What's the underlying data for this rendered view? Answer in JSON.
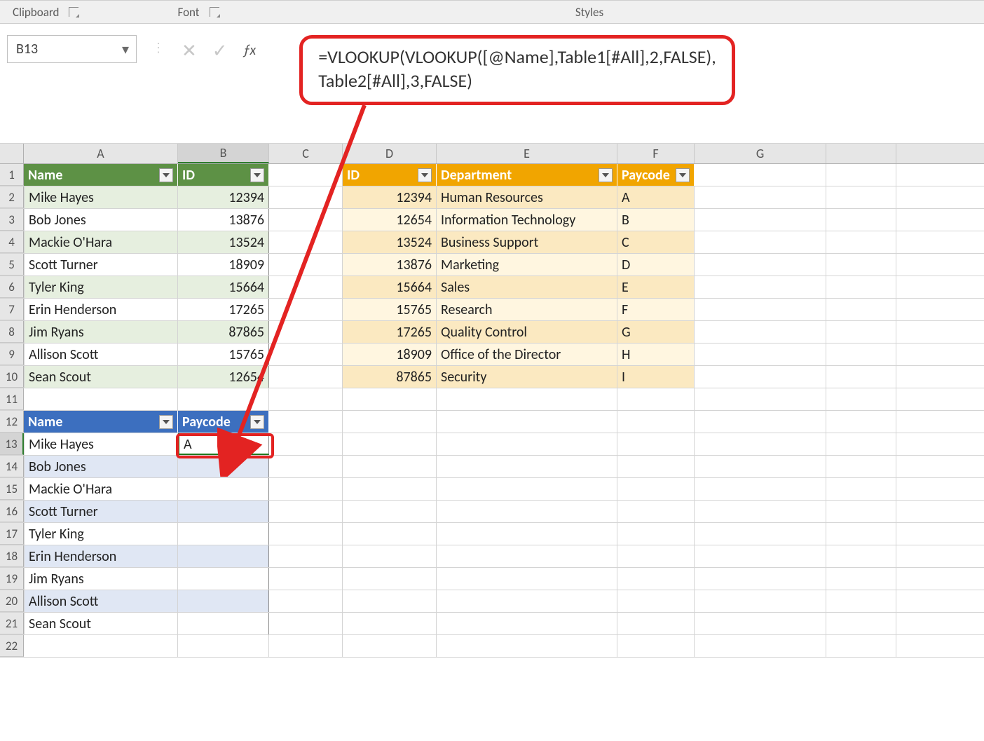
{
  "ribbon": {
    "clipboard": "Clipboard",
    "font": "Font",
    "styles": "Styles"
  },
  "namebox": "B13",
  "formula_line1": "=VLOOKUP(VLOOKUP([@Name],Table1[#All],2,FALSE),",
  "formula_line2": "Table2[#All],3,FALSE)",
  "columns": [
    "A",
    "B",
    "C",
    "D",
    "E",
    "F",
    "G"
  ],
  "table1": {
    "headers": [
      "Name",
      "ID"
    ],
    "rows": [
      [
        "Mike Hayes",
        "12394"
      ],
      [
        "Bob Jones",
        "13876"
      ],
      [
        "Mackie O'Hara",
        "13524"
      ],
      [
        "Scott Turner",
        "18909"
      ],
      [
        "Tyler King",
        "15664"
      ],
      [
        "Erin Henderson",
        "17265"
      ],
      [
        "Jim Ryans",
        "87865"
      ],
      [
        "Allison Scott",
        "15765"
      ],
      [
        "Sean Scout",
        "12654"
      ]
    ]
  },
  "table2": {
    "headers": [
      "ID",
      "Department",
      "Paycode"
    ],
    "rows": [
      [
        "12394",
        "Human Resources",
        "A"
      ],
      [
        "12654",
        "Information Technology",
        "B"
      ],
      [
        "13524",
        "Business Support",
        "C"
      ],
      [
        "13876",
        "Marketing",
        "D"
      ],
      [
        "15664",
        "Sales",
        "E"
      ],
      [
        "15765",
        "Research",
        "F"
      ],
      [
        "17265",
        "Quality Control",
        "G"
      ],
      [
        "18909",
        "Office of the Director",
        "H"
      ],
      [
        "87865",
        "Security",
        "I"
      ]
    ]
  },
  "table3": {
    "headers": [
      "Name",
      "Paycode"
    ],
    "rows": [
      [
        "Mike Hayes",
        "A"
      ],
      [
        "Bob Jones",
        ""
      ],
      [
        "Mackie O'Hara",
        ""
      ],
      [
        "Scott Turner",
        ""
      ],
      [
        "Tyler King",
        ""
      ],
      [
        "Erin Henderson",
        ""
      ],
      [
        "Jim Ryans",
        ""
      ],
      [
        "Allison Scott",
        ""
      ],
      [
        "Sean Scout",
        ""
      ]
    ]
  }
}
